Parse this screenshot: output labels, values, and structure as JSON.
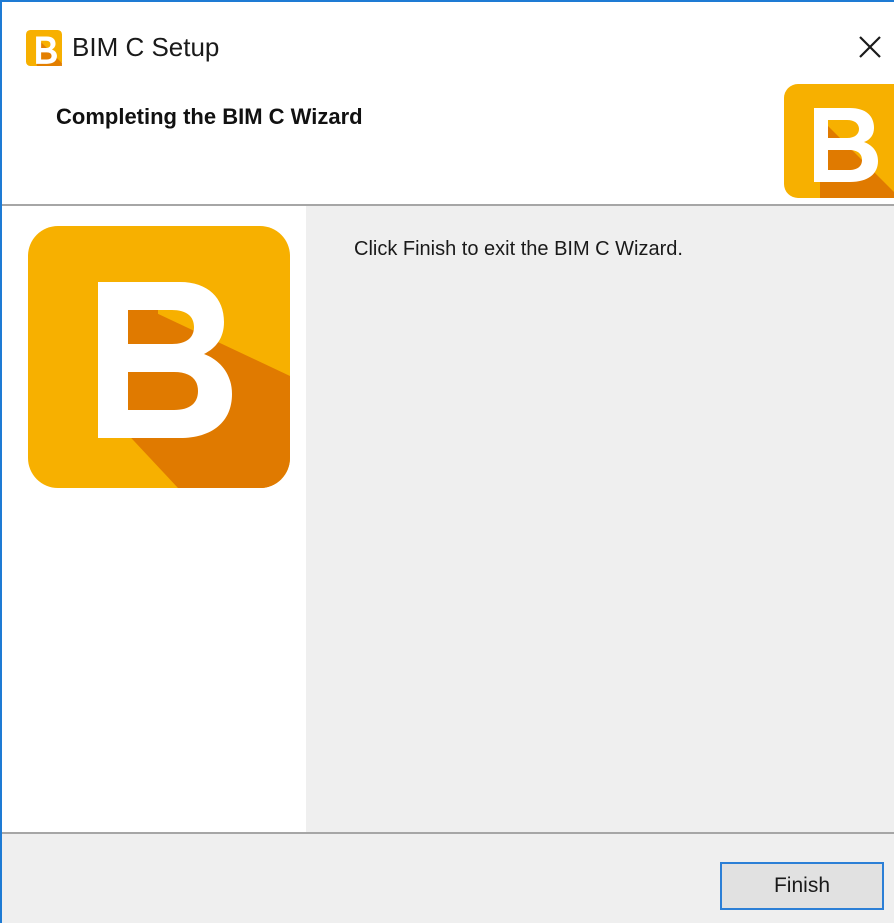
{
  "window": {
    "title": "BIM C Setup",
    "close_label": "✕"
  },
  "header": {
    "title": "Completing the BIM C Wizard"
  },
  "body": {
    "message": "Click Finish to exit the BIM C Wizard."
  },
  "footer": {
    "finish_label": "Finish"
  },
  "icons": {
    "app": "bim-c-logo-icon",
    "close": "close-icon",
    "header_logo": "bim-c-logo-icon",
    "side_logo": "bim-c-logo-icon"
  },
  "colors": {
    "brand_yellow": "#f7b000",
    "brand_orange": "#e07a00",
    "accent_blue": "#1e7bd4"
  }
}
